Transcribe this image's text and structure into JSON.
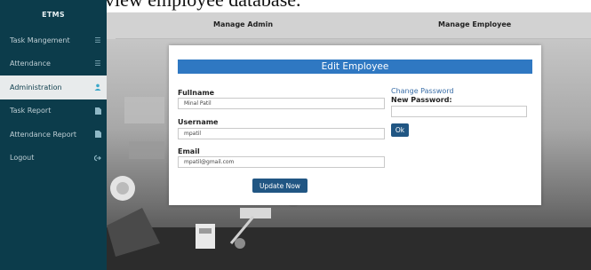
{
  "top_fragment": "view employee database.",
  "sidebar": {
    "brand": "ETMS",
    "items": [
      {
        "label": "Task Mangement",
        "icon": "list-icon",
        "active": false
      },
      {
        "label": "Attendance",
        "icon": "list-icon",
        "active": false
      },
      {
        "label": "Administration",
        "icon": "user-icon",
        "active": true
      },
      {
        "label": "Task Report",
        "icon": "document-icon",
        "active": false
      },
      {
        "label": "Attendance Report",
        "icon": "document-icon",
        "active": false
      },
      {
        "label": "Logout",
        "icon": "logout-icon",
        "active": false
      }
    ]
  },
  "header": {
    "tab_admin": "Manage Admin",
    "tab_employee": "Manage Employee"
  },
  "modal": {
    "title": "Edit Employee",
    "fullname_label": "Fullname",
    "fullname_value": "Minal Patil",
    "username_label": "Username",
    "username_value": "mpatil",
    "email_label": "Email",
    "email_value": "mpatil@gmail.com",
    "update_button": "Update Now",
    "change_password_link": "Change Password",
    "new_password_label": "New Password:",
    "new_password_value": "",
    "ok_button": "Ok"
  },
  "colors": {
    "sidebar_bg": "#0c3c4b",
    "modal_header": "#2f78c2",
    "button_bg": "#215683",
    "link": "#3c6fa8"
  }
}
